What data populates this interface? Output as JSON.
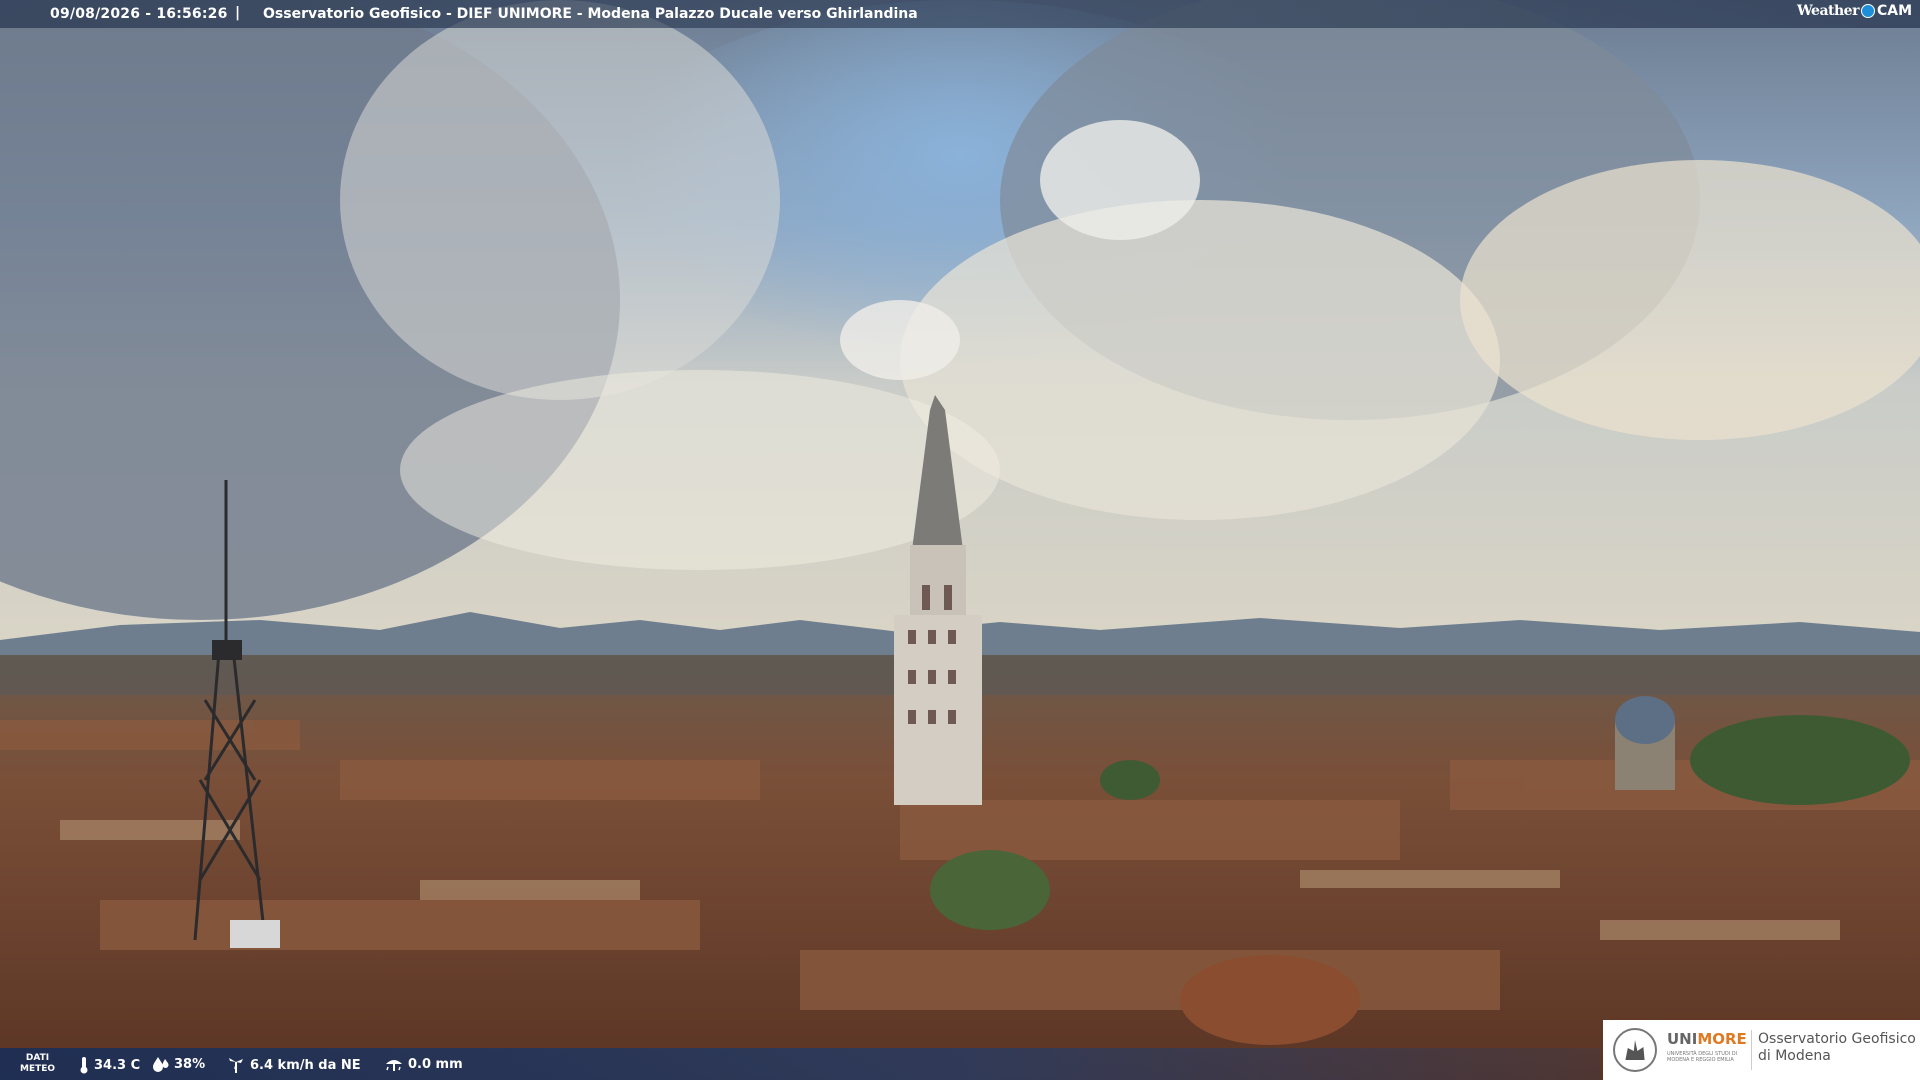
{
  "header": {
    "timestamp": "09/08/2026 - 16:56:26",
    "separator": "|",
    "caption": "Osservatorio Geofisico - DIEF UNIMORE - Modena Palazzo Ducale verso Ghirlandina",
    "brand_left": "Weather",
    "brand_right": "CAM"
  },
  "footer": {
    "label_line1": "DATI",
    "label_line2": "METEO",
    "temperature": "34.3 C",
    "humidity": "38%",
    "wind": "6.4 km/h da NE",
    "rain": "0.0 mm",
    "icons": [
      "thermometer-icon",
      "humidity-drop-icon",
      "wind-icon",
      "rain-gauge-icon"
    ]
  },
  "logo": {
    "uni_prefix": "UNI",
    "uni_suffix": "MORE",
    "uni_small": "UNIVERSITÀ DEGLI STUDI DI MODENA E REGGIO EMILIA",
    "obs_line1": "Osservatorio Geofisico",
    "obs_line2": "di Modena"
  },
  "colors": {
    "sky_top": "#6f8096",
    "sky_blue": "#8fb3d8",
    "cloud": "#e8e4da",
    "roofs": "#7a4a32",
    "tower": "#d2cbc1",
    "accent_orange": "#e07a22"
  }
}
